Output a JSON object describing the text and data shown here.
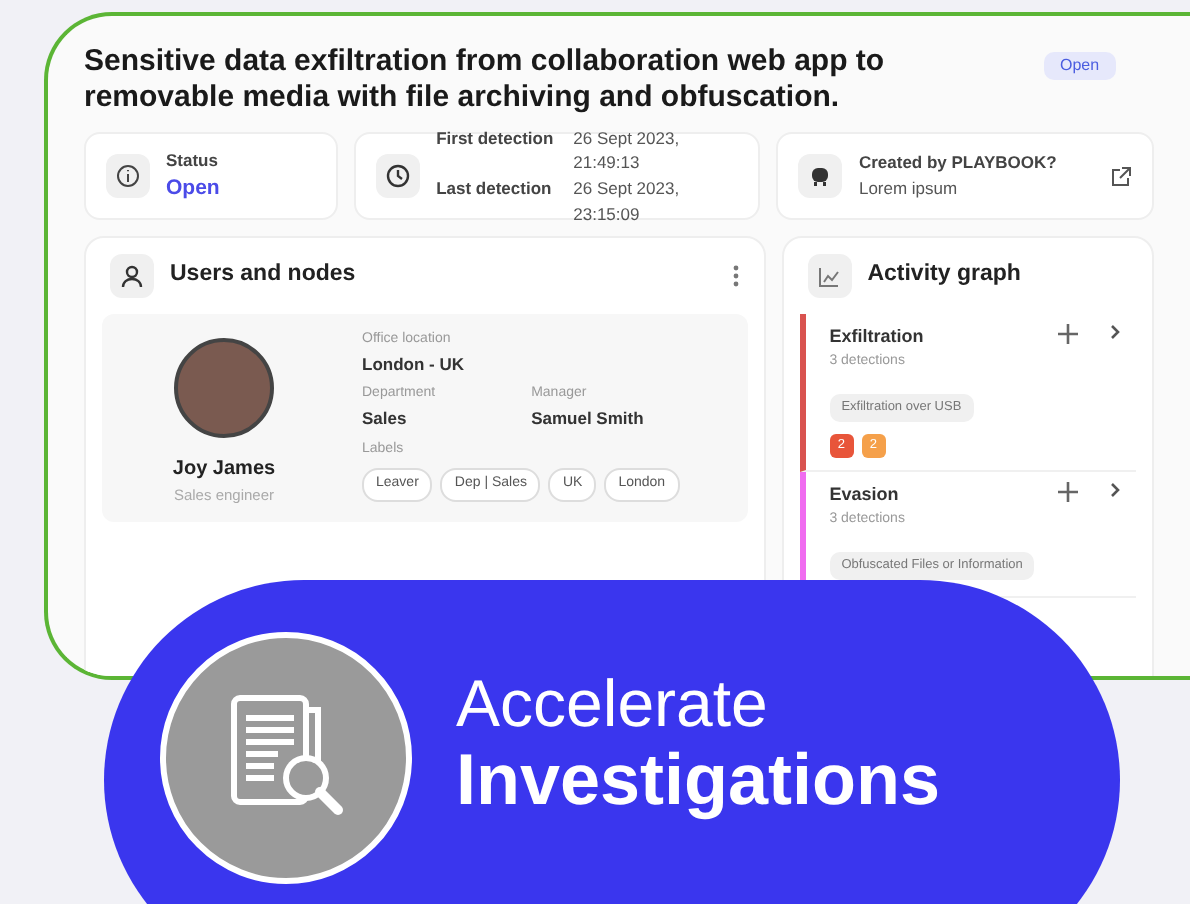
{
  "case": {
    "title": "Sensitive data exfiltration from collaboration web app to removable media with file archiving and obfuscation.",
    "badge": "Open"
  },
  "info": [
    {
      "kind": "status",
      "label": "Status",
      "value": "Open"
    },
    {
      "kind": "detection",
      "rows": [
        {
          "label": "First detection",
          "value": "26 Sept 2023, 21:49:13"
        },
        {
          "label": "Last detection",
          "value": "26 Sept 2023, 23:15:09"
        }
      ]
    },
    {
      "kind": "creator",
      "label": "Created by PLAYBOOK?",
      "value": "Lorem ipsum"
    }
  ],
  "users_panel": {
    "title": "Users and nodes",
    "user": {
      "name": "Joy James",
      "role": "Sales engineer",
      "fields": [
        {
          "label": "Office location",
          "value": "London - UK"
        },
        {
          "label": "Department",
          "value": "Sales"
        },
        {
          "label": "Manager",
          "value": "Samuel Smith"
        }
      ],
      "labels_title": "Labels",
      "labels": [
        "Leaver",
        "Dep | Sales",
        "UK",
        "London"
      ]
    }
  },
  "activity_panel": {
    "title": "Activity graph",
    "items": [
      {
        "name": "Exfiltration",
        "count": "3 detections",
        "color": "#d9534f",
        "tag": "Exfiltration over USB",
        "badges": [
          {
            "text": "2",
            "color": "#e8553a"
          },
          {
            "text": "2",
            "color": "#f5a04a"
          }
        ]
      },
      {
        "name": "Evasion",
        "count": "3 detections",
        "color": "#f06cf0",
        "tag": "Obfuscated Files or Information"
      }
    ]
  },
  "banner": {
    "line_1": "Accelerate",
    "line_2": "Investigations"
  }
}
